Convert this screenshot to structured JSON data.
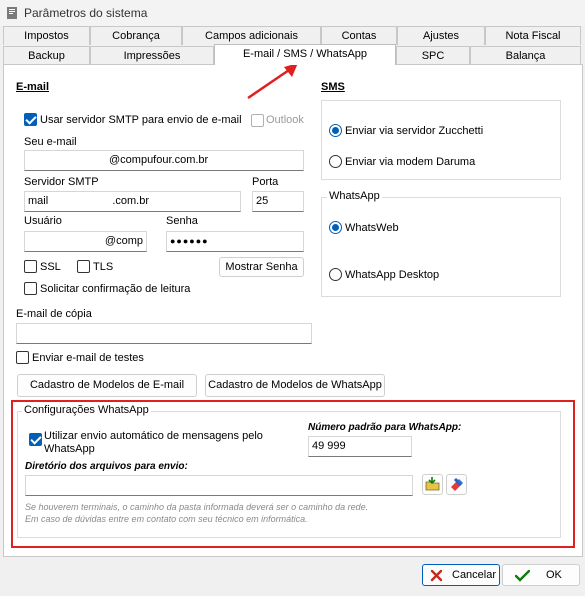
{
  "window": {
    "title": "Parâmetros do sistema"
  },
  "tabs": {
    "row1": [
      "Impostos",
      "Cobrança",
      "Campos adicionais",
      "Contas",
      "Ajustes",
      "Nota Fiscal"
    ],
    "row2": [
      "Backup",
      "Impressões",
      "E-mail / SMS / WhatsApp",
      "SPC",
      "Balança"
    ],
    "active": "E-mail / SMS / WhatsApp"
  },
  "email": {
    "heading": "E-mail",
    "use_smtp_label": "Usar servidor SMTP para envio de e-mail",
    "outlook_label": "Outlook",
    "your_email_label": "Seu e-mail",
    "your_email_value": "@compufour.com.br",
    "smtp_label": "Servidor SMTP",
    "smtp_value": "mail                     .com.br",
    "port_label": "Porta",
    "port_value": "25",
    "user_label": "Usuário",
    "user_value": "@comp",
    "password_label": "Senha",
    "password_value": "●●●●●●",
    "ssl_label": "SSL",
    "tls_label": "TLS",
    "show_password_label": "Mostrar Senha",
    "read_receipt_label": "Solicitar confirmação de leitura",
    "copy_label": "E-mail de cópia",
    "copy_value": "",
    "test_label": "Enviar e-mail de testes",
    "email_models_button": "Cadastro de Modelos de E-mail",
    "whatsapp_models_button": "Cadastro de Modelos de WhatsApp"
  },
  "sms": {
    "heading": "SMS",
    "option_zucchetti": "Enviar via servidor Zucchetti",
    "option_daruma": "Enviar via modem Daruma",
    "selected": "Enviar via servidor Zucchetti"
  },
  "whatsapp": {
    "heading": "WhatsApp",
    "option_web": "WhatsWeb",
    "option_desktop": "WhatsApp Desktop",
    "selected": "WhatsWeb"
  },
  "whatsapp_config": {
    "heading": "Configurações WhatsApp",
    "auto_send_line1": "Utilizar envio automático de mensagens pelo",
    "auto_send_line2": "WhatsApp",
    "default_number_label": "Número padrão para WhatsApp:",
    "default_number_value": "49 999",
    "directory_label": "Diretório dos arquivos para envio:",
    "directory_value": "",
    "help_line1": "Se houverem terminais, o caminho da pasta informada deverá ser o caminho da rede.",
    "help_line2": "Em caso de dúvidas entre em contato com seu técnico em informática."
  },
  "footer": {
    "cancel_label": "Cancelar",
    "ok_label": "OK"
  },
  "colors": {
    "accent": "#005fb8",
    "highlight": "#e01f1f",
    "cancel_icon": "#c42b1c",
    "ok_icon": "#107c10"
  }
}
